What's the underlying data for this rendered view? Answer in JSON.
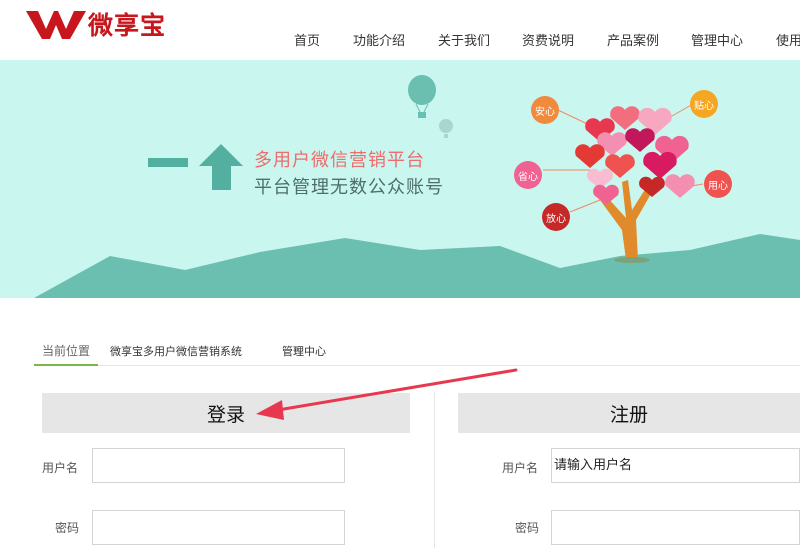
{
  "header": {
    "logo_text": "微享宝",
    "nav": [
      {
        "label": "首页"
      },
      {
        "label": "功能介绍"
      },
      {
        "label": "关于我们"
      },
      {
        "label": "资费说明"
      },
      {
        "label": "产品案例"
      },
      {
        "label": "管理中心"
      },
      {
        "label": "使用"
      }
    ]
  },
  "banner": {
    "tagline_1": "多用户微信营销平台",
    "tagline_2": "平台管理无数公众账号",
    "bubbles": [
      "安心",
      "贴心",
      "省心",
      "用心",
      "放心"
    ]
  },
  "breadcrumb": {
    "current_label": "当前位置",
    "site_link": "微享宝多用户微信营销系统",
    "separator": "»",
    "page": "管理中心"
  },
  "login": {
    "title": "登录",
    "username_label": "用户名",
    "username_value": "",
    "password_label": "密码",
    "password_value": ""
  },
  "register": {
    "title": "注册",
    "username_label": "用户名",
    "username_placeholder": "请输入用户名",
    "password_label": "密码",
    "password_value": ""
  },
  "colors": {
    "brand_red": "#c8161d",
    "banner_bg": "#c9f6ee",
    "mountain": "#6bbfb0",
    "accent_green": "#7ab648",
    "annotation_arrow": "#e8384f"
  }
}
